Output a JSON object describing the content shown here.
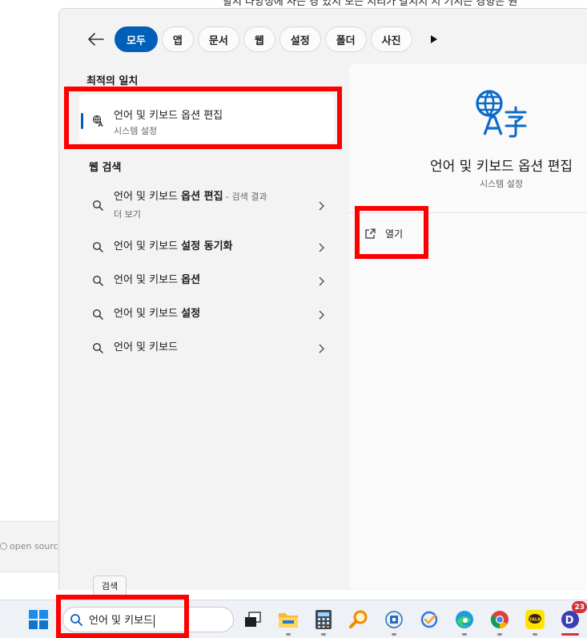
{
  "background": {
    "top_text": "할지 다양성에 사는 경 있지 모든 지리가 갈치지 지 기지는 경향은 원",
    "left_text": "open source"
  },
  "filters": {
    "back_label": "back",
    "chips": [
      {
        "label": "모두",
        "active": true
      },
      {
        "label": "앱"
      },
      {
        "label": "문서"
      },
      {
        "label": "웹"
      },
      {
        "label": "설정"
      },
      {
        "label": "폴더"
      },
      {
        "label": "사진"
      }
    ]
  },
  "best_match": {
    "section_title": "최적의 일치",
    "name": "언어 및 키보드 옵션 편집",
    "subtitle": "시스템 설정"
  },
  "web_search": {
    "section_title": "웹 검색",
    "items": [
      {
        "prefix": "언어 및 키보드 ",
        "bold": "옵션 편집",
        "note": " - 검색 결과",
        "line2": "더 보기"
      },
      {
        "prefix": "언어 및 키보드 ",
        "bold": "설정 동기화"
      },
      {
        "prefix": "언어 및 키보드 ",
        "bold": "옵션"
      },
      {
        "prefix": "언어 및 키보드 ",
        "bold": "설정"
      },
      {
        "prefix": "언어 및 키보드",
        "bold": ""
      }
    ]
  },
  "detail": {
    "title": "언어 및 키보드 옵션 편집",
    "subtitle": "시스템 설정",
    "open_label": "열기"
  },
  "taskbar": {
    "tooltip": "검색",
    "search_value": "언어 및 키보드",
    "notification_badge": "23",
    "kakao_label": "TALK"
  },
  "colors": {
    "accent": "#005fb8",
    "highlight": "#ff0000",
    "panel_bg": "#f3f3f3"
  }
}
